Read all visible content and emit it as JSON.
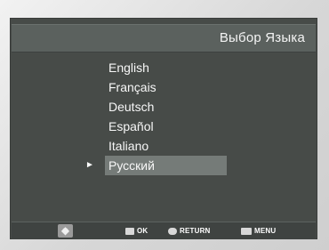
{
  "header": {
    "title": "Выбор Языка"
  },
  "languages": [
    {
      "label": "English"
    },
    {
      "label": "Français"
    },
    {
      "label": "Deutsch"
    },
    {
      "label": "Español"
    },
    {
      "label": "Italiano"
    },
    {
      "label": "Русский"
    }
  ],
  "selected_index": 5,
  "selection_marker": "►",
  "footer": {
    "ok_label": "OK",
    "return_label": "RETURN",
    "menu_label": "MENU"
  },
  "colors": {
    "screen": "#474b48",
    "title_bar": "#5b615e",
    "highlight": "#757b78",
    "text": "#f7f7f7"
  },
  "icons": {
    "dpad": "directional-pad-icon",
    "ok": "ok-icon",
    "return": "return-icon",
    "menu": "menu-icon"
  }
}
